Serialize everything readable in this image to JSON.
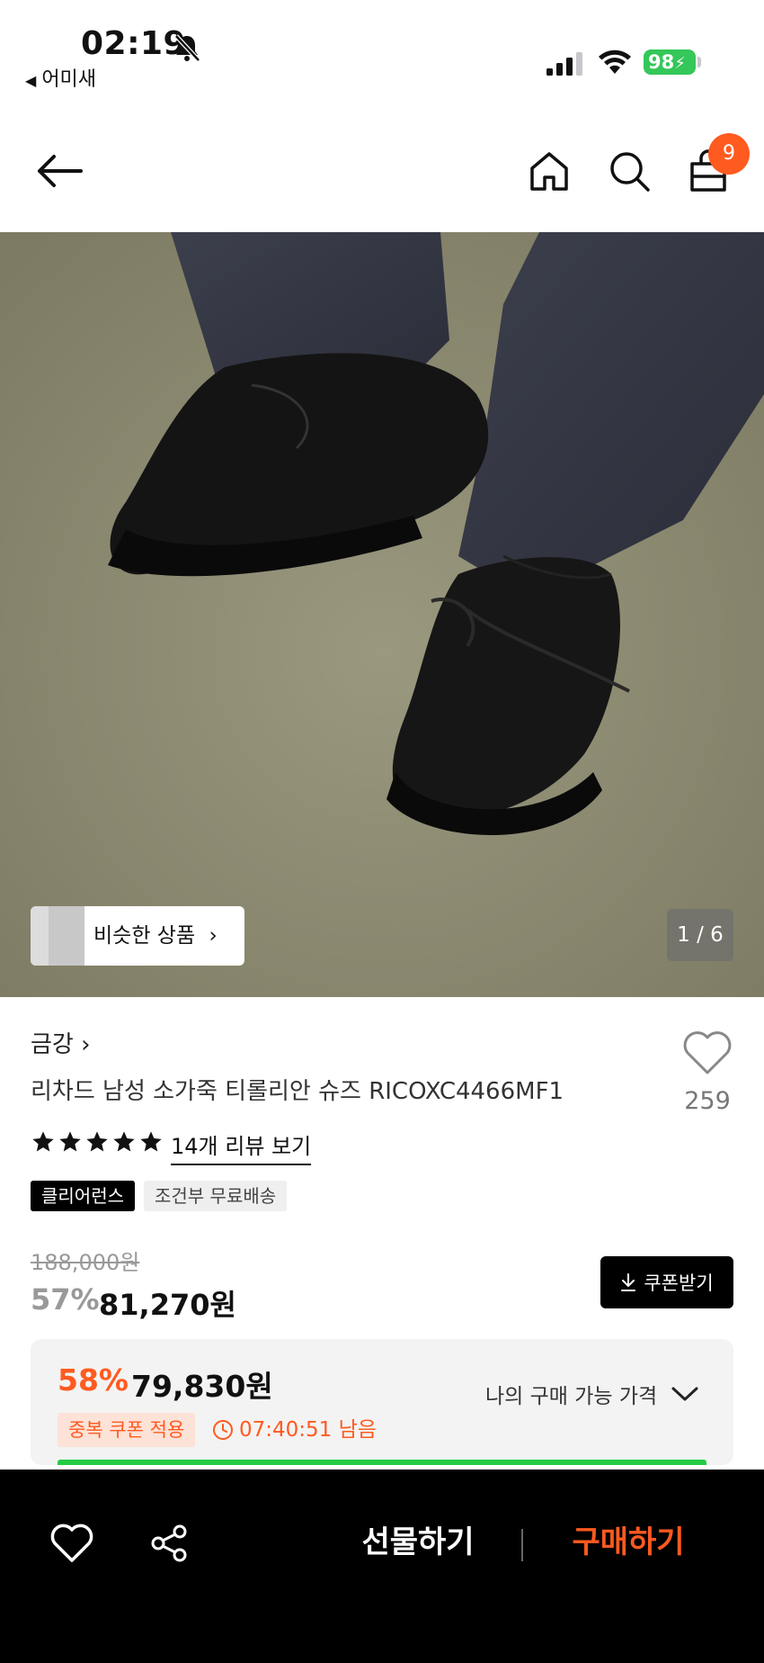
{
  "status_bar": {
    "time": "02:19",
    "back_app": "어미새",
    "battery": "98"
  },
  "header": {
    "cart_count": "9",
    "icons": [
      "back-arrow-icon",
      "home-icon",
      "search-icon",
      "shopping-bag-icon"
    ]
  },
  "gallery": {
    "similar_label": "비슷한 상품",
    "page_indicator": "1 / 6"
  },
  "product": {
    "brand": "금강",
    "title": "리차드 남성 소가죽 티롤리안 슈즈 RICOXC4466MF1",
    "like_count": "259",
    "rating_stars": 5,
    "review_link": "14개 리뷰 보기",
    "tags": [
      "클리어런스",
      "조건부 무료배송"
    ]
  },
  "pricing": {
    "original_price": "188,000원",
    "discount_rate": "57%",
    "sale_price": "81,270원",
    "coupon_button": "쿠폰받기",
    "best_rate": "58%",
    "best_price": "79,830원",
    "coupon_applied_badge": "중복 쿠폰 적용",
    "timer": "07:40:51 남음",
    "my_price_label": "나의 구매 가능 가격"
  },
  "bottom_bar": {
    "gift_label": "선물하기",
    "buy_label": "구매하기"
  },
  "colors": {
    "accent": "#ff5a1f",
    "battery": "#34c759",
    "bar_green": "#22cc44"
  }
}
